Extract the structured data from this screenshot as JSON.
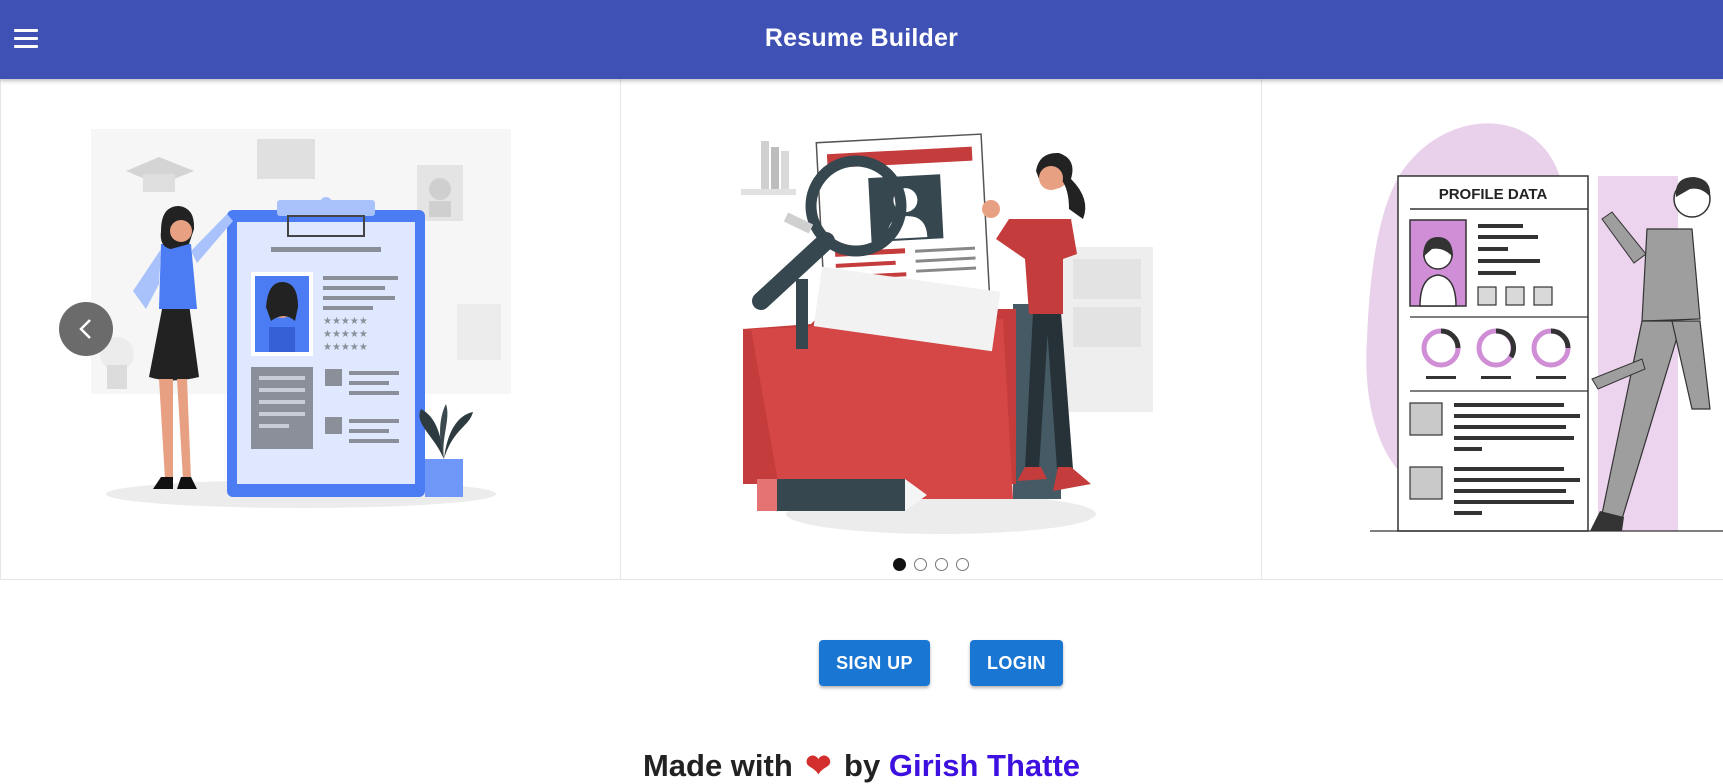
{
  "appbar": {
    "title": "Resume Builder",
    "menu_icon": "hamburger-menu-icon",
    "color": "#3f51b5"
  },
  "carousel": {
    "slides": [
      {
        "name": "job-application-illustration"
      },
      {
        "name": "resume-search-illustration"
      },
      {
        "name": "profile-data-illustration",
        "heading": "PROFILE DATA"
      }
    ],
    "indicators": [
      {
        "active": true
      },
      {
        "active": false
      },
      {
        "active": false
      },
      {
        "active": false
      }
    ]
  },
  "actions": {
    "signup_label": "SIGN UP",
    "login_label": "LOGIN",
    "button_color": "#1976d2"
  },
  "footer": {
    "prefix": "Made with",
    "heart": "❤",
    "by": "by",
    "author": "Girish Thatte"
  }
}
